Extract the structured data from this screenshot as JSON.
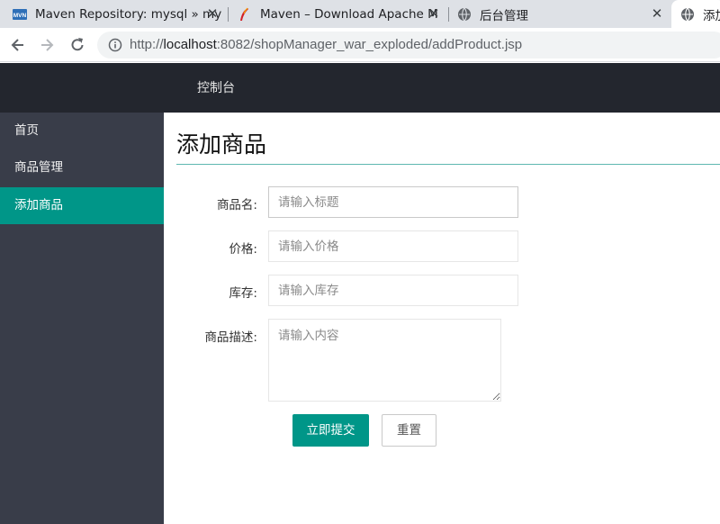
{
  "browser": {
    "tabs": [
      {
        "title": "Maven Repository: mysql » my",
        "favicon": "maven-mvn-icon"
      },
      {
        "title": "Maven – Download Apache M",
        "favicon": "apache-feather-icon"
      },
      {
        "title": "后台管理",
        "favicon": "globe-icon"
      },
      {
        "title": "添加",
        "favicon": "globe-icon"
      }
    ],
    "url_prefix": "http://",
    "url_host": "localhost",
    "url_rest": ":8082/shopManager_war_exploded/addProduct.jsp"
  },
  "topnav": {
    "console_label": "控制台"
  },
  "sidebar": {
    "items": [
      {
        "label": "首页"
      },
      {
        "label": "商品管理"
      },
      {
        "label": "添加商品"
      }
    ]
  },
  "page": {
    "title": "添加商品"
  },
  "form": {
    "name": {
      "label": "商品名:",
      "placeholder": "请输入标题",
      "value": ""
    },
    "price": {
      "label": "价格:",
      "placeholder": "请输入价格",
      "value": ""
    },
    "stock": {
      "label": "库存:",
      "placeholder": "请输入库存",
      "value": ""
    },
    "description": {
      "label": "商品描述:",
      "placeholder": "请输入内容",
      "value": ""
    },
    "submit_label": "立即提交",
    "reset_label": "重置"
  },
  "colors": {
    "accent": "#009688",
    "topnav_bg": "#23262e",
    "sidebar_bg": "#393d49"
  }
}
